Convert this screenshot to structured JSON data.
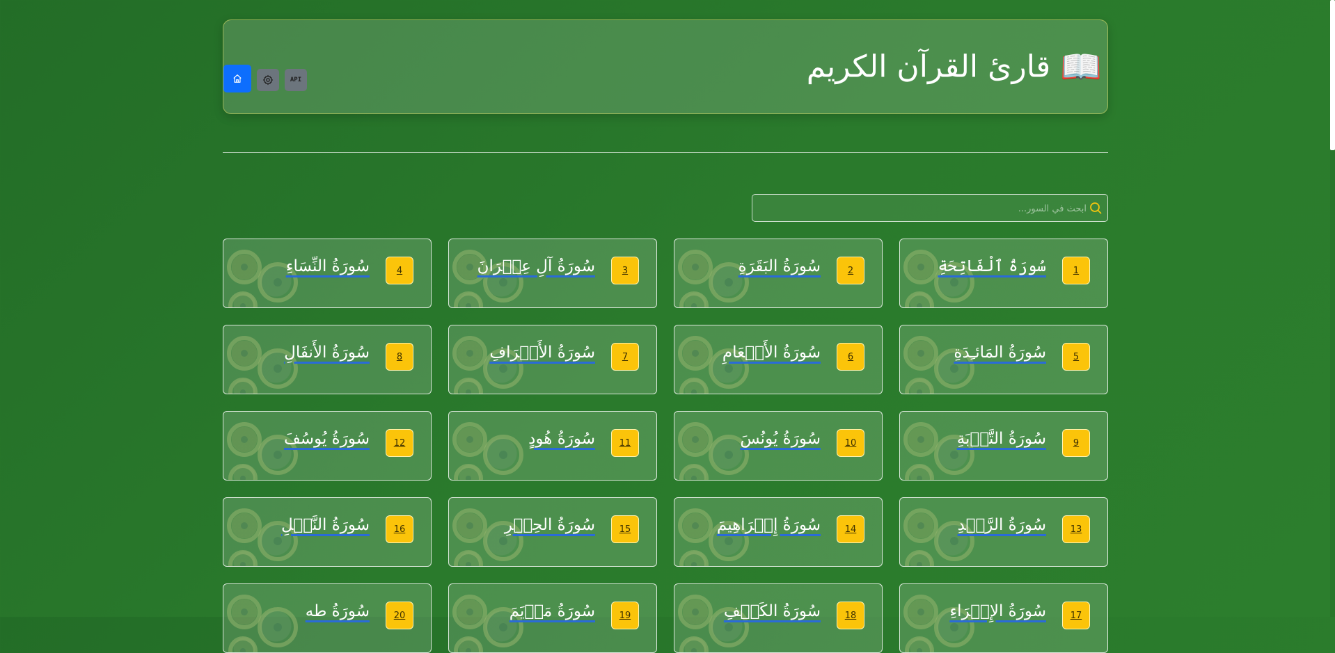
{
  "header": {
    "title": "قارئ القرآن الكريم",
    "book_icon": "📖",
    "api_label": "API"
  },
  "search": {
    "placeholder": "ابحث في السور..."
  },
  "colors": {
    "background": "#2a7a2c",
    "badge": "#fbc40a",
    "home_button": "#0d6efd",
    "secondary_button": "#6c757d"
  },
  "surahs": [
    {
      "number": "1",
      "name": "سُورَةُ ٱلْفَاتِحَةِ"
    },
    {
      "number": "2",
      "name": "سُورَةُ البَقَرَةِ"
    },
    {
      "number": "3",
      "name": "سُورَةُ آلِ عِمۡرَانَ"
    },
    {
      "number": "4",
      "name": "سُورَةُ النِّسَاءِ"
    },
    {
      "number": "5",
      "name": "سُورَةُ المَائـِدَةِ"
    },
    {
      "number": "6",
      "name": "سُورَةُ الأَنۡعَامِ"
    },
    {
      "number": "7",
      "name": "سُورَةُ الأَعۡرَافِ"
    },
    {
      "number": "8",
      "name": "سُورَةُ الأَنفَالِ"
    },
    {
      "number": "9",
      "name": "سُورَةُ التَّوۡبَةِ"
    },
    {
      "number": "10",
      "name": "سُورَةُ يُونُسَ"
    },
    {
      "number": "11",
      "name": "سُورَةُ هُودٍ"
    },
    {
      "number": "12",
      "name": "سُورَةُ يُوسُفَ"
    },
    {
      "number": "13",
      "name": "سُورَةُ الرَّعۡدِ"
    },
    {
      "number": "14",
      "name": "سُورَةُ إِبۡرَاهِيمَ"
    },
    {
      "number": "15",
      "name": "سُورَةُ الحِجۡرِ"
    },
    {
      "number": "16",
      "name": "سُورَةُ النَّحۡلِ"
    },
    {
      "number": "17",
      "name": "سُورَةُ الإِسۡرَاءِ"
    },
    {
      "number": "18",
      "name": "سُورَةُ الكَهۡفِ"
    },
    {
      "number": "19",
      "name": "سُورَةُ مَرۡيَمَ"
    },
    {
      "number": "20",
      "name": "سُورَةُ طه"
    }
  ]
}
